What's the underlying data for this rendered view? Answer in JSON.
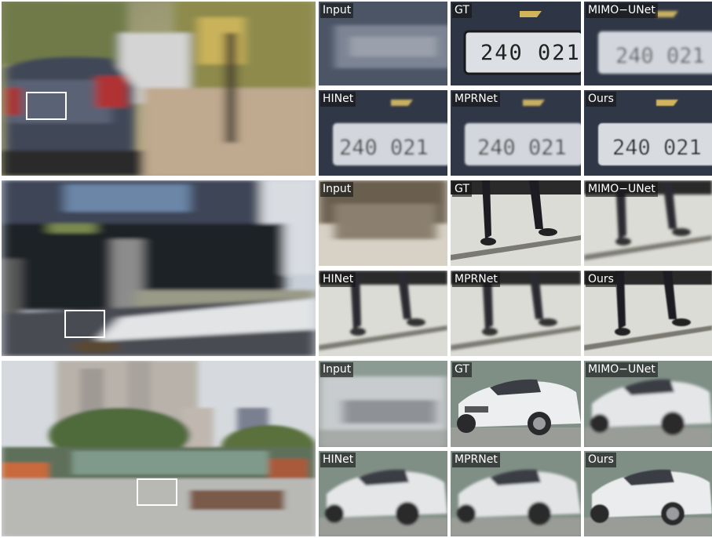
{
  "method_labels": [
    "Input",
    "GT",
    "MIMO−UNet",
    "HINet",
    "MPRNet",
    "Ours"
  ],
  "rows": [
    {
      "scene": "car-street",
      "plate_text": "240 021"
    },
    {
      "scene": "building-pedestrian",
      "plate_text": ""
    },
    {
      "scene": "city-white-car",
      "plate_text": ""
    }
  ],
  "colors": {
    "label_bg": "#222222",
    "label_text": "#ffffff",
    "box": "#ffffff",
    "separator": "#ffffff"
  }
}
